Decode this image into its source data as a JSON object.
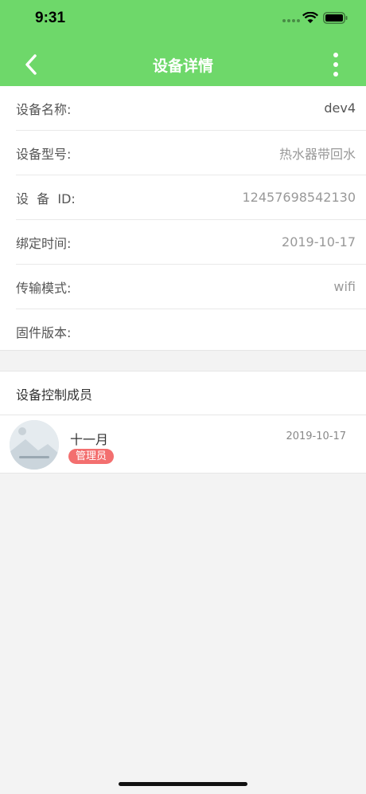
{
  "status_bar": {
    "time": "9:31"
  },
  "nav": {
    "title": "设备详情",
    "back_icon": "chevron-left-icon",
    "more_icon": "more-vertical-icon"
  },
  "device_info": [
    {
      "label": "设备名称:",
      "value": "dev4"
    },
    {
      "label": "设备型号:",
      "value": "热水器带回水"
    },
    {
      "label": "设  备  ID:",
      "value": "12457698542130"
    },
    {
      "label": "绑定时间:",
      "value": "2019-10-17"
    },
    {
      "label": "传输模式:",
      "value": "wifi"
    },
    {
      "label": "固件版本:",
      "value": ""
    }
  ],
  "members": {
    "title": "设备控制成员",
    "items": [
      {
        "name": "十一月",
        "role": "管理员",
        "date": "2019-10-17"
      }
    ]
  },
  "colors": {
    "header": "#6ed86a",
    "badge": "#f36f6f",
    "background": "#f3f3f3"
  }
}
